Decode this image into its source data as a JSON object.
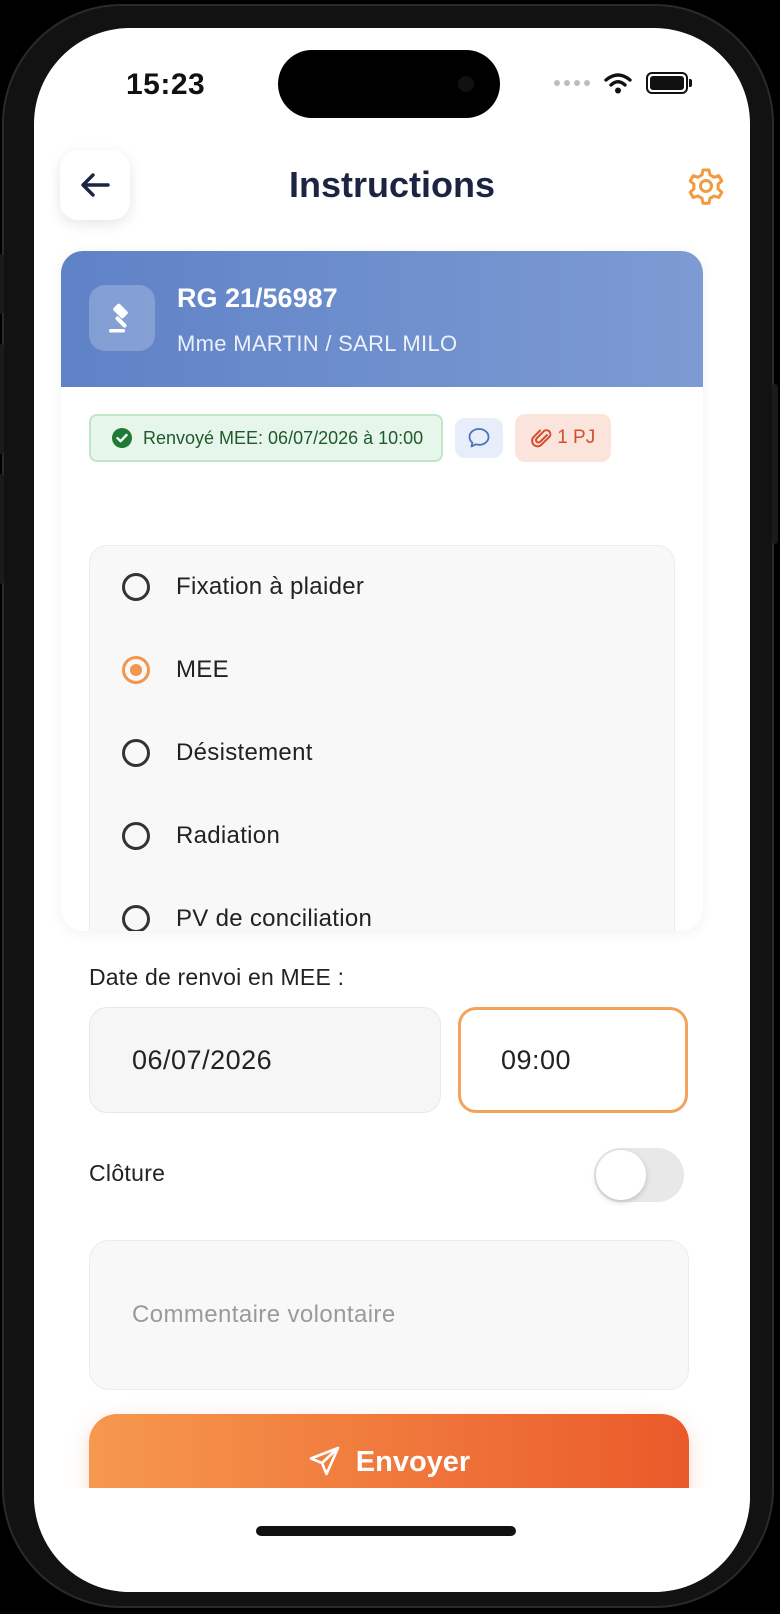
{
  "status_bar": {
    "time": "15:23"
  },
  "header": {
    "title": "Instructions"
  },
  "case": {
    "reference": "RG 21/56987",
    "parties": "Mme MARTIN / SARL MILO",
    "status_chip": "Renvoyé MEE: 06/07/2026 à 10:00",
    "attachments_chip": "1 PJ"
  },
  "options": [
    {
      "label": "Fixation à plaider",
      "selected": false
    },
    {
      "label": "MEE",
      "selected": true
    },
    {
      "label": "Désistement",
      "selected": false
    },
    {
      "label": "Radiation",
      "selected": false
    },
    {
      "label": "PV de conciliation",
      "selected": false
    }
  ],
  "form": {
    "date_label": "Date de renvoi en MEE :",
    "date_value": "06/07/2026",
    "time_value": "09:00",
    "cloture_label": "Clôture",
    "cloture_on": false,
    "comment_placeholder": "Commentaire volontaire",
    "send_label": "Envoyer"
  },
  "colors": {
    "accent": "#f2954e",
    "case_header": "#6a8ccc",
    "status_green": "#1f5a2e",
    "attach_red": "#d44e2e"
  },
  "icons": [
    "back-arrow-icon",
    "gear-icon",
    "gavel-icon",
    "check-circle-icon",
    "chat-bubble-icon",
    "paperclip-icon",
    "send-icon"
  ]
}
